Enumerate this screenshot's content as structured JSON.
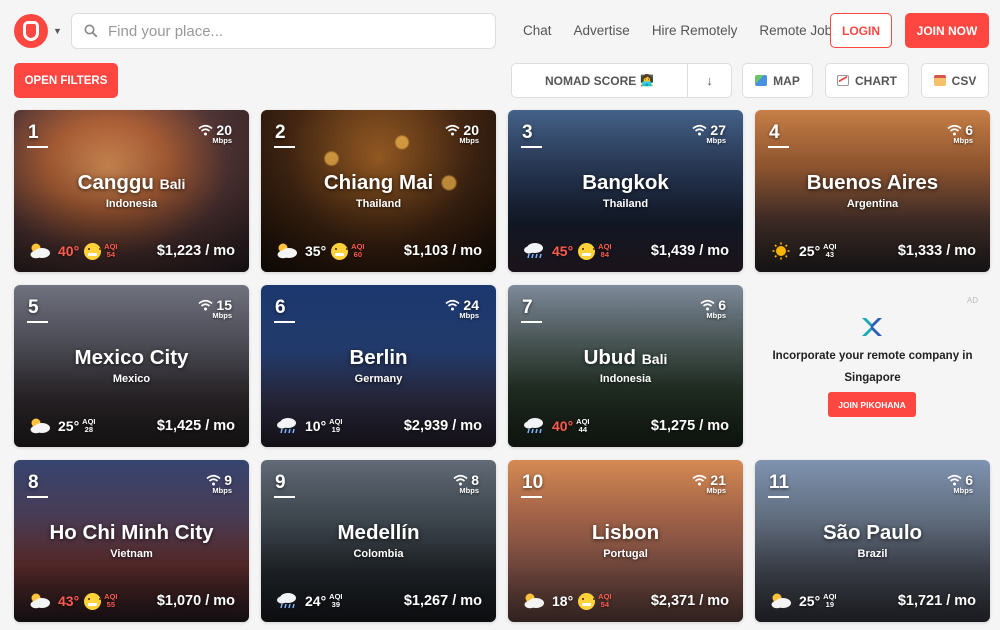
{
  "search": {
    "placeholder": "Find your place..."
  },
  "nav": {
    "chat": "Chat",
    "advertise": "Advertise",
    "hire": "Hire Remotely",
    "jobs": "Remote Jobs"
  },
  "auth": {
    "login": "LOGIN",
    "join": "JOIN NOW"
  },
  "toolbar": {
    "filters": "OPEN FILTERS",
    "sort_label": "NOMAD SCORE",
    "sort_dir": "↓",
    "map": "MAP",
    "chart": "CHART",
    "csv": "CSV"
  },
  "colors": {
    "accent": "#ff4742"
  },
  "cities": [
    {
      "rank": "1",
      "name": "Canggu",
      "sub": "Bali",
      "country": "Indonesia",
      "speed": "20",
      "unit": "Mbps",
      "temp": "40°",
      "aqi_label": "AQI",
      "aqi": "54",
      "cost": "$1,223 / mo",
      "weather": "partly-cloudy-icon",
      "face": true,
      "hot": true,
      "bad": true
    },
    {
      "rank": "2",
      "name": "Chiang Mai",
      "sub": "",
      "country": "Thailand",
      "speed": "20",
      "unit": "Mbps",
      "temp": "35°",
      "aqi_label": "AQI",
      "aqi": "60",
      "cost": "$1,103 / mo",
      "weather": "partly-cloudy-icon",
      "face": true,
      "hot": false,
      "bad": true
    },
    {
      "rank": "3",
      "name": "Bangkok",
      "sub": "",
      "country": "Thailand",
      "speed": "27",
      "unit": "Mbps",
      "temp": "45°",
      "aqi_label": "AQI",
      "aqi": "84",
      "cost": "$1,439 / mo",
      "weather": "rain-icon",
      "face": true,
      "hot": true,
      "bad": true
    },
    {
      "rank": "4",
      "name": "Buenos Aires",
      "sub": "",
      "country": "Argentina",
      "speed": "6",
      "unit": "Mbps",
      "temp": "25°",
      "aqi_label": "AQI",
      "aqi": "43",
      "cost": "$1,333 / mo",
      "weather": "sun-icon",
      "face": false,
      "hot": false,
      "bad": false
    },
    {
      "rank": "5",
      "name": "Mexico City",
      "sub": "",
      "country": "Mexico",
      "speed": "15",
      "unit": "Mbps",
      "temp": "25°",
      "aqi_label": "AQI",
      "aqi": "28",
      "cost": "$1,425 / mo",
      "weather": "partly-cloudy-icon",
      "face": false,
      "hot": false,
      "bad": false
    },
    {
      "rank": "6",
      "name": "Berlin",
      "sub": "",
      "country": "Germany",
      "speed": "24",
      "unit": "Mbps",
      "temp": "10°",
      "aqi_label": "AQI",
      "aqi": "19",
      "cost": "$2,939 / mo",
      "weather": "rain-icon",
      "face": false,
      "hot": false,
      "bad": false
    },
    {
      "rank": "7",
      "name": "Ubud",
      "sub": "Bali",
      "country": "Indonesia",
      "speed": "6",
      "unit": "Mbps",
      "temp": "40°",
      "aqi_label": "AQI",
      "aqi": "44",
      "cost": "$1,275 / mo",
      "weather": "rain-icon",
      "face": false,
      "hot": true,
      "bad": false
    },
    {
      "rank": "8",
      "name": "Ho Chi Minh City",
      "sub": "",
      "country": "Vietnam",
      "speed": "9",
      "unit": "Mbps",
      "temp": "43°",
      "aqi_label": "AQI",
      "aqi": "55",
      "cost": "$1,070 / mo",
      "weather": "partly-cloudy-icon",
      "face": true,
      "hot": true,
      "bad": true
    },
    {
      "rank": "9",
      "name": "Medellín",
      "sub": "",
      "country": "Colombia",
      "speed": "8",
      "unit": "Mbps",
      "temp": "24°",
      "aqi_label": "AQI",
      "aqi": "39",
      "cost": "$1,267 / mo",
      "weather": "rain-icon",
      "face": false,
      "hot": false,
      "bad": false
    },
    {
      "rank": "10",
      "name": "Lisbon",
      "sub": "",
      "country": "Portugal",
      "speed": "21",
      "unit": "Mbps",
      "temp": "18°",
      "aqi_label": "AQI",
      "aqi": "54",
      "cost": "$2,371 / mo",
      "weather": "partly-cloudy-icon",
      "face": true,
      "hot": false,
      "bad": true
    },
    {
      "rank": "11",
      "name": "São Paulo",
      "sub": "",
      "country": "Brazil",
      "speed": "6",
      "unit": "Mbps",
      "temp": "25°",
      "aqi_label": "AQI",
      "aqi": "19",
      "cost": "$1,721 / mo",
      "weather": "partly-cloudy-icon",
      "face": false,
      "hot": false,
      "bad": false
    }
  ],
  "ad": {
    "tag": "AD",
    "text": "Incorporate your remote company in Singapore",
    "button": "JOIN PIKOHANA"
  }
}
